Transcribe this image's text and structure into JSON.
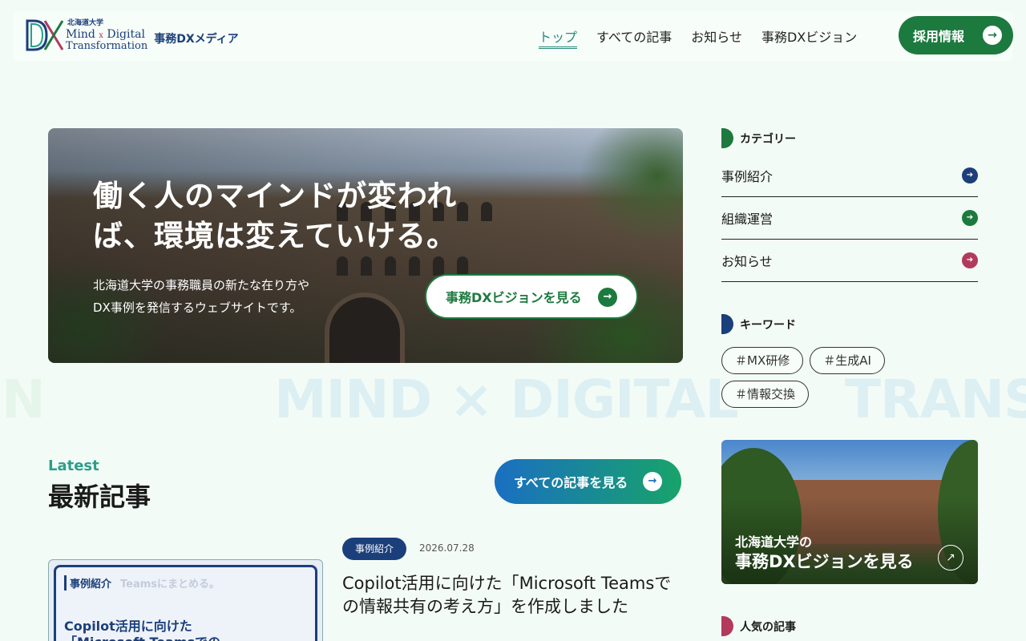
{
  "header": {
    "logo": {
      "univ": "北海道大学",
      "line1a": "Mind",
      "cross": "x",
      "line1b": "Digital",
      "line2": "Transformation",
      "media": "事務DXメディア"
    },
    "nav": [
      {
        "label": "トップ",
        "active": true
      },
      {
        "label": "すべての記事",
        "active": false
      },
      {
        "label": "お知らせ",
        "active": false
      },
      {
        "label": "事務DXビジョン",
        "active": false
      }
    ],
    "recruit_label": "採用情報"
  },
  "hero": {
    "title_line1": "働く人のマインドが変われ",
    "title_line2": "ば、環境は変えていける。",
    "sub_line1": "北海道大学の事務職員の新たな在り方や",
    "sub_line2": "DX事例を発信するウェブサイトです。",
    "button_label": "事務DXビジョンを見る"
  },
  "marquee": {
    "text1": "ON",
    "text2": "MIND × DIGITAL",
    "text3": "TRANSF"
  },
  "latest": {
    "label_en": "Latest",
    "label_ja": "最新記事",
    "all_button_label": "すべての記事を見る"
  },
  "post": {
    "category": "事例紹介",
    "date": "2026.07.28",
    "title": "Copilot活用に向けた「Microsoft Teamsでの情報共有の考え方」を作成しました",
    "thumb_category": "事例紹介",
    "thumb_bg_text": "Teamsにまとめる。",
    "thumb_line1": "Copilot活用に向けた",
    "thumb_line2": "「Microsoft Teamsでの"
  },
  "sidebar": {
    "category_heading": "カテゴリー",
    "categories": [
      {
        "label": "事例紹介",
        "color": "#1b3f7a"
      },
      {
        "label": "組織運営",
        "color": "#1d7a3f"
      },
      {
        "label": "お知らせ",
        "color": "#b23a5c"
      }
    ],
    "keyword_heading": "キーワード",
    "keywords": [
      "＃MX研修",
      "＃生成AI",
      "＃情報交換"
    ],
    "vision_card_line1": "北海道大学の",
    "vision_card_line2": "事務DXビジョンを見る",
    "popular_heading": "人気の記事"
  },
  "colors": {
    "brand_green": "#1d7a3f",
    "brand_navy": "#1b3f7a",
    "accent_teal": "#2c9e8a",
    "accent_pink": "#b23a5c",
    "background": "#f3fbf6"
  }
}
